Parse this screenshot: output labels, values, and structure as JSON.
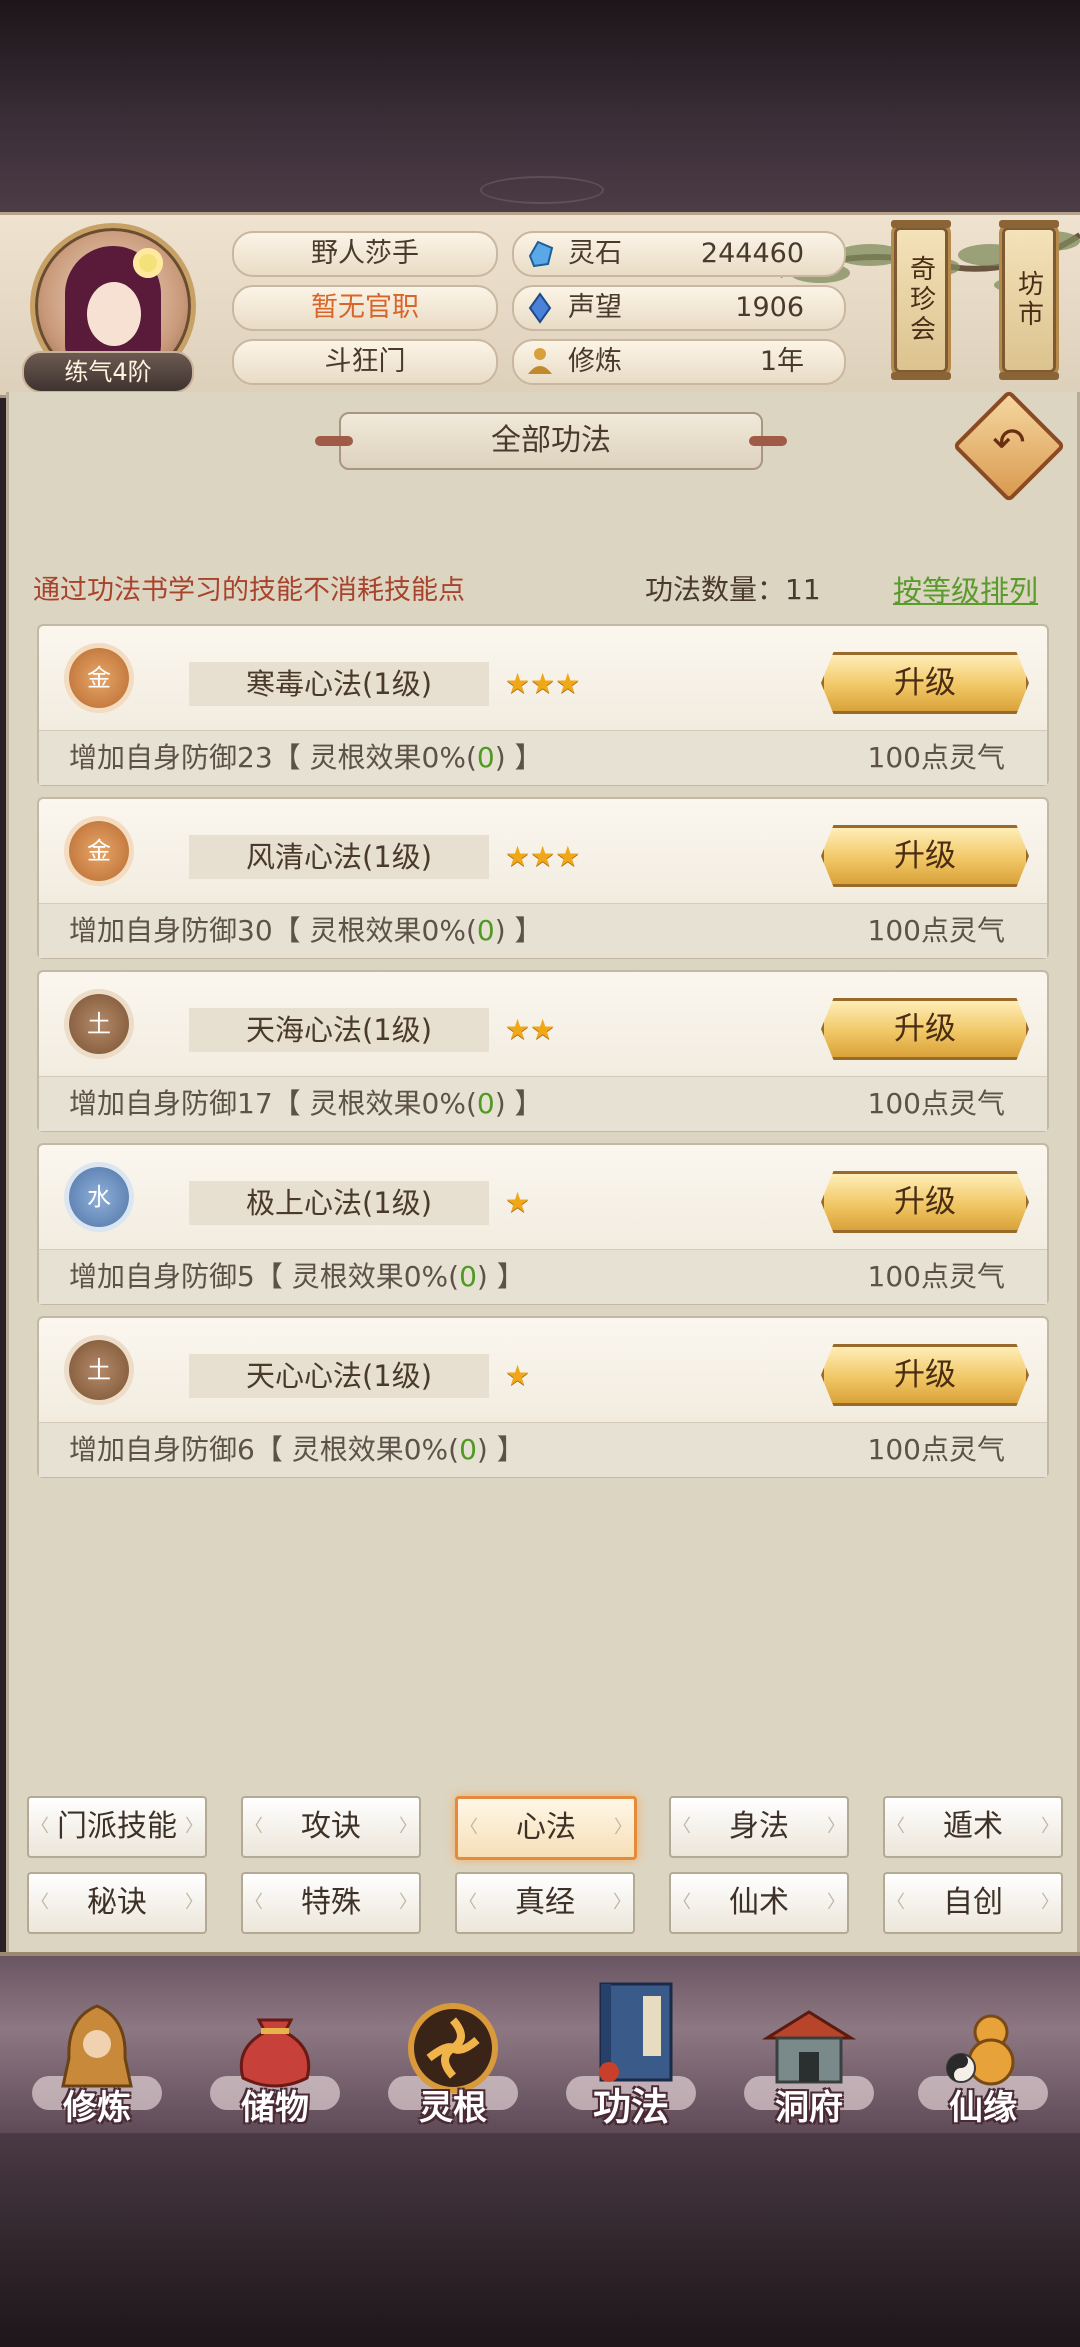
{
  "player": {
    "name": "野人莎手",
    "official": "暂无官职",
    "sect": "斗狂门",
    "realm": "练气4阶"
  },
  "stats": [
    {
      "label": "灵石",
      "value": "244460",
      "icon": "spirit-stone-icon",
      "color": "#5aa8e8"
    },
    {
      "label": "声望",
      "value": "1906",
      "icon": "prestige-gem-icon",
      "color": "#4a82d8"
    },
    {
      "label": "修炼",
      "value": "1年",
      "icon": "meditation-icon",
      "color": "#d8a03a"
    }
  ],
  "side_buttons": {
    "treasure": "奇珍会",
    "market": "坊市"
  },
  "panel": {
    "title": "全部功法",
    "hint": "通过功法书学习的技能不消耗技能点",
    "count_label": "功法数量：11",
    "sort_label": "按等级排列"
  },
  "skills": [
    {
      "element": "金",
      "name": "寒毒心法(1级)",
      "stars": "★★★",
      "upgrade": "升级",
      "effect_prefix": "增加自身防御23【 灵根效果0%(",
      "effect_bonus": "0",
      "effect_suffix": ") 】",
      "cost": "100点灵气"
    },
    {
      "element": "金",
      "name": "风清心法(1级)",
      "stars": "★★★",
      "upgrade": "升级",
      "effect_prefix": "增加自身防御30【 灵根效果0%(",
      "effect_bonus": "0",
      "effect_suffix": ") 】",
      "cost": "100点灵气"
    },
    {
      "element": "土",
      "name": "天海心法(1级)",
      "stars": "★★",
      "upgrade": "升级",
      "effect_prefix": "增加自身防御17【 灵根效果0%(",
      "effect_bonus": "0",
      "effect_suffix": ") 】",
      "cost": "100点灵气"
    },
    {
      "element": "水",
      "name": "极上心法(1级)",
      "stars": "★",
      "upgrade": "升级",
      "effect_prefix": "增加自身防御5【 灵根效果0%(",
      "effect_bonus": "0",
      "effect_suffix": ") 】",
      "cost": "100点灵气"
    },
    {
      "element": "土",
      "name": "天心心法(1级)",
      "stars": "★",
      "upgrade": "升级",
      "effect_prefix": "增加自身防御6【 灵根效果0%(",
      "effect_bonus": "0",
      "effect_suffix": ") 】",
      "cost": "100点灵气"
    }
  ],
  "categories": [
    {
      "label": "门派技能",
      "active": false
    },
    {
      "label": "攻诀",
      "active": false
    },
    {
      "label": "心法",
      "active": true
    },
    {
      "label": "身法",
      "active": false
    },
    {
      "label": "遁术",
      "active": false
    },
    {
      "label": "秘诀",
      "active": false
    },
    {
      "label": "特殊",
      "active": false
    },
    {
      "label": "真经",
      "active": false
    },
    {
      "label": "仙术",
      "active": false
    },
    {
      "label": "自创",
      "active": false
    }
  ],
  "nav": [
    {
      "label": "修炼",
      "icon": "hooded-cultivator-icon",
      "active": false
    },
    {
      "label": "储物",
      "icon": "storage-pouch-icon",
      "active": false
    },
    {
      "label": "灵根",
      "icon": "spirit-root-icon",
      "active": false
    },
    {
      "label": "功法",
      "icon": "technique-book-icon",
      "active": true
    },
    {
      "label": "洞府",
      "icon": "cave-mansion-icon",
      "active": false
    },
    {
      "label": "仙缘",
      "icon": "immortal-fate-icon",
      "active": false
    }
  ]
}
